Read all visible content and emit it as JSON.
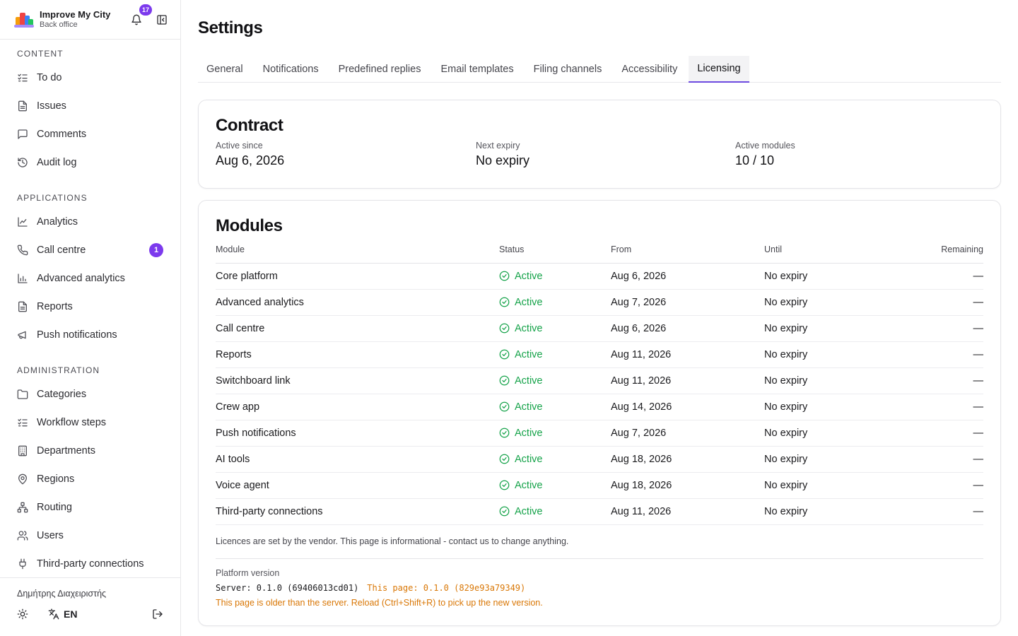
{
  "brand": {
    "title": "Improve My City",
    "subtitle": "Back office",
    "notification_count": "17"
  },
  "sidebar": {
    "sections": [
      {
        "title": "CONTENT",
        "items": [
          {
            "label": "To do",
            "icon": "list-check-icon"
          },
          {
            "label": "Issues",
            "icon": "file-text-icon"
          },
          {
            "label": "Comments",
            "icon": "message-square-icon"
          },
          {
            "label": "Audit log",
            "icon": "history-icon"
          }
        ]
      },
      {
        "title": "APPLICATIONS",
        "items": [
          {
            "label": "Analytics",
            "icon": "line-chart-icon"
          },
          {
            "label": "Call centre",
            "icon": "phone-icon",
            "badge": "1"
          },
          {
            "label": "Advanced analytics",
            "icon": "bar-chart-icon"
          },
          {
            "label": "Reports",
            "icon": "file-text-icon"
          },
          {
            "label": "Push notifications",
            "icon": "megaphone-icon"
          }
        ]
      },
      {
        "title": "ADMINISTRATION",
        "items": [
          {
            "label": "Categories",
            "icon": "folder-icon"
          },
          {
            "label": "Workflow steps",
            "icon": "list-check-icon"
          },
          {
            "label": "Departments",
            "icon": "building-icon"
          },
          {
            "label": "Regions",
            "icon": "map-pin-icon"
          },
          {
            "label": "Routing",
            "icon": "network-icon"
          },
          {
            "label": "Users",
            "icon": "users-icon"
          },
          {
            "label": "Third-party connections",
            "icon": "plug-icon"
          }
        ]
      }
    ],
    "footer": {
      "user": "Δημήτρης Διαχειριστής",
      "language": "EN"
    }
  },
  "page": {
    "title": "Settings",
    "tabs": [
      "General",
      "Notifications",
      "Predefined replies",
      "Email templates",
      "Filing channels",
      "Accessibility",
      "Licensing"
    ],
    "active_tab": "Licensing"
  },
  "contract": {
    "title": "Contract",
    "active_since_label": "Active since",
    "active_since": "Aug 6, 2026",
    "next_expiry_label": "Next expiry",
    "next_expiry": "No expiry",
    "active_modules_label": "Active modules",
    "active_modules": "10 / 10"
  },
  "modules": {
    "title": "Modules",
    "columns": {
      "module": "Module",
      "status": "Status",
      "from": "From",
      "until": "Until",
      "remaining": "Remaining"
    },
    "rows": [
      {
        "module": "Core platform",
        "status": "Active",
        "from": "Aug 6, 2026",
        "until": "No expiry",
        "remaining": "—"
      },
      {
        "module": "Advanced analytics",
        "status": "Active",
        "from": "Aug 7, 2026",
        "until": "No expiry",
        "remaining": "—"
      },
      {
        "module": "Call centre",
        "status": "Active",
        "from": "Aug 6, 2026",
        "until": "No expiry",
        "remaining": "—"
      },
      {
        "module": "Reports",
        "status": "Active",
        "from": "Aug 11, 2026",
        "until": "No expiry",
        "remaining": "—"
      },
      {
        "module": "Switchboard link",
        "status": "Active",
        "from": "Aug 11, 2026",
        "until": "No expiry",
        "remaining": "—"
      },
      {
        "module": "Crew app",
        "status": "Active",
        "from": "Aug 14, 2026",
        "until": "No expiry",
        "remaining": "—"
      },
      {
        "module": "Push notifications",
        "status": "Active",
        "from": "Aug 7, 2026",
        "until": "No expiry",
        "remaining": "—"
      },
      {
        "module": "AI tools",
        "status": "Active",
        "from": "Aug 18, 2026",
        "until": "No expiry",
        "remaining": "—"
      },
      {
        "module": "Voice agent",
        "status": "Active",
        "from": "Aug 18, 2026",
        "until": "No expiry",
        "remaining": "—"
      },
      {
        "module": "Third-party connections",
        "status": "Active",
        "from": "Aug 11, 2026",
        "until": "No expiry",
        "remaining": "—"
      }
    ],
    "note": "Licences are set by the vendor. This page is informational - contact us to change anything.",
    "platform_version_label": "Platform version",
    "server_version": "Server: 0.1.0 (69406013cd01)",
    "page_version": "This page: 0.1.0 (829e93a79349)",
    "version_warning": "This page is older than the server. Reload (Ctrl+Shift+R) to pick up the new version."
  },
  "colors": {
    "accent": "#7c3aed",
    "active_status": "#16a34a",
    "warning": "#d97706"
  }
}
